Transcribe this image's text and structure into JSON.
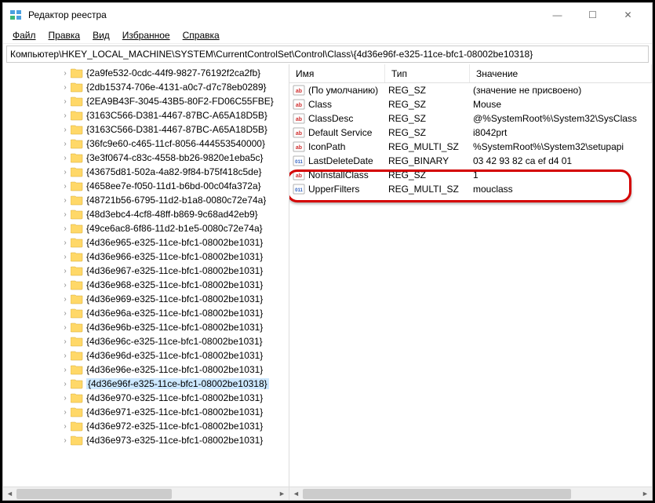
{
  "window": {
    "title": "Редактор реестра",
    "minimize": "—",
    "maximize": "☐",
    "close": "✕"
  },
  "menubar": {
    "file": "Файл",
    "edit": "Правка",
    "view": "Вид",
    "favorites": "Избранное",
    "help": "Справка"
  },
  "address": "Компьютер\\HKEY_LOCAL_MACHINE\\SYSTEM\\CurrentControlSet\\Control\\Class\\{4d36e96f-e325-11ce-bfc1-08002be10318}",
  "tree": {
    "items": [
      {
        "label": "{2a9fe532-0cdc-44f9-9827-76192f2ca2fb}",
        "expandable": true
      },
      {
        "label": "{2db15374-706e-4131-a0c7-d7c78eb0289}",
        "expandable": true
      },
      {
        "label": "{2EA9B43F-3045-43B5-80F2-FD06C55FBE}",
        "expandable": true
      },
      {
        "label": "{3163C566-D381-4467-87BC-A65A18D5B}",
        "expandable": true
      },
      {
        "label": "{3163C566-D381-4467-87BC-A65A18D5B}",
        "expandable": true
      },
      {
        "label": "{36fc9e60-c465-11cf-8056-444553540000}",
        "expandable": true
      },
      {
        "label": "{3e3f0674-c83c-4558-bb26-9820e1eba5c}",
        "expandable": true
      },
      {
        "label": "{43675d81-502a-4a82-9f84-b75f418c5de}",
        "expandable": true
      },
      {
        "label": "{4658ee7e-f050-11d1-b6bd-00c04fa372a}",
        "expandable": true
      },
      {
        "label": "{48721b56-6795-11d2-b1a8-0080c72e74a}",
        "expandable": true
      },
      {
        "label": "{48d3ebc4-4cf8-48ff-b869-9c68ad42eb9}",
        "expandable": true
      },
      {
        "label": "{49ce6ac8-6f86-11d2-b1e5-0080c72e74a}",
        "expandable": true
      },
      {
        "label": "{4d36e965-e325-11ce-bfc1-08002be1031}",
        "expandable": true
      },
      {
        "label": "{4d36e966-e325-11ce-bfc1-08002be1031}",
        "expandable": true
      },
      {
        "label": "{4d36e967-e325-11ce-bfc1-08002be1031}",
        "expandable": true
      },
      {
        "label": "{4d36e968-e325-11ce-bfc1-08002be1031}",
        "expandable": true
      },
      {
        "label": "{4d36e969-e325-11ce-bfc1-08002be1031}",
        "expandable": true
      },
      {
        "label": "{4d36e96a-e325-11ce-bfc1-08002be1031}",
        "expandable": true
      },
      {
        "label": "{4d36e96b-e325-11ce-bfc1-08002be1031}",
        "expandable": true
      },
      {
        "label": "{4d36e96c-e325-11ce-bfc1-08002be1031}",
        "expandable": true
      },
      {
        "label": "{4d36e96d-e325-11ce-bfc1-08002be1031}",
        "expandable": true
      },
      {
        "label": "{4d36e96e-e325-11ce-bfc1-08002be1031}",
        "expandable": true
      },
      {
        "label": "{4d36e96f-e325-11ce-bfc1-08002be10318}",
        "expandable": true,
        "selected": true
      },
      {
        "label": "{4d36e970-e325-11ce-bfc1-08002be1031}",
        "expandable": true
      },
      {
        "label": "{4d36e971-e325-11ce-bfc1-08002be1031}",
        "expandable": true
      },
      {
        "label": "{4d36e972-e325-11ce-bfc1-08002be1031}",
        "expandable": true
      },
      {
        "label": "{4d36e973-e325-11ce-bfc1-08002be1031}",
        "expandable": true
      }
    ]
  },
  "list": {
    "columns": {
      "name": "Имя",
      "type": "Тип",
      "data": "Значение"
    },
    "rows": [
      {
        "icon": "sz",
        "name": "(По умолчанию)",
        "type": "REG_SZ",
        "data": "(значение не присвоено)"
      },
      {
        "icon": "sz",
        "name": "Class",
        "type": "REG_SZ",
        "data": "Mouse"
      },
      {
        "icon": "sz",
        "name": "ClassDesc",
        "type": "REG_SZ",
        "data": "@%SystemRoot%\\System32\\SysClass"
      },
      {
        "icon": "sz",
        "name": "Default Service",
        "type": "REG_SZ",
        "data": "i8042prt"
      },
      {
        "icon": "sz",
        "name": "IconPath",
        "type": "REG_MULTI_SZ",
        "data": "%SystemRoot%\\System32\\setupapi"
      },
      {
        "icon": "bin",
        "name": "LastDeleteDate",
        "type": "REG_BINARY",
        "data": "03 42 93 82 ca ef d4 01"
      },
      {
        "icon": "sz",
        "name": "NoInstallClass",
        "type": "REG_SZ",
        "data": "1"
      },
      {
        "icon": "bin",
        "name": "UpperFilters",
        "type": "REG_MULTI_SZ",
        "data": "mouclass"
      }
    ]
  }
}
